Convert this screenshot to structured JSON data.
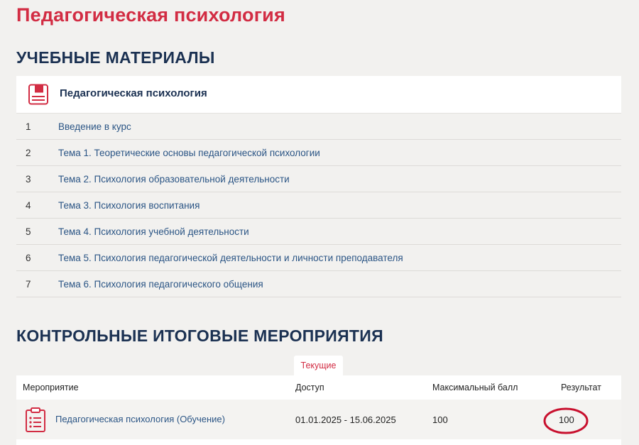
{
  "page": {
    "title": "Педагогическая психология"
  },
  "materials": {
    "section_title": "УЧЕБНЫЕ МАТЕРИАЛЫ",
    "card_title": "Педагогическая психология",
    "card_icon": "book-icon",
    "topics": [
      {
        "num": "1",
        "label": "Введение в курс"
      },
      {
        "num": "2",
        "label": "Тема 1. Теоретические основы педагогической психологии"
      },
      {
        "num": "3",
        "label": "Тема 2. Психология образовательной деятельности"
      },
      {
        "num": "4",
        "label": "Тема 3. Психология воспитания"
      },
      {
        "num": "5",
        "label": "Тема 4. Психология учебной деятельности"
      },
      {
        "num": "6",
        "label": "Тема 5. Психология педагогической деятельности и личности преподавателя"
      },
      {
        "num": "7",
        "label": "Тема 6. Психология педагогического общения"
      }
    ]
  },
  "events": {
    "section_title": "КОНТРОЛЬНЫЕ ИТОГОВЫЕ МЕРОПРИЯТИЯ",
    "tab_label": "Текущие",
    "columns": {
      "event": "Мероприятие",
      "access": "Доступ",
      "max_score": "Максимальный балл",
      "result": "Результат"
    },
    "rows": [
      {
        "icon": "clipboard-icon",
        "event": "Педагогическая психология (Обучение)",
        "access": "01.01.2025 - 15.06.2025",
        "max_score": "100",
        "result": "100"
      }
    ]
  },
  "colors": {
    "accent_red": "#d22c43",
    "heading_navy": "#1b3152",
    "link_blue": "#2b5585",
    "annotation_red": "#c8102e"
  }
}
